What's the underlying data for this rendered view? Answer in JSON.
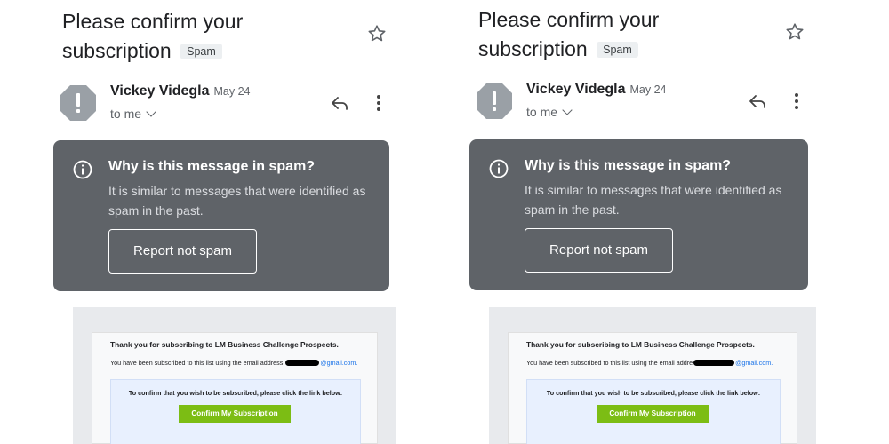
{
  "panels": [
    {
      "subject": "Please confirm your subscription",
      "spam_label": "Spam",
      "sender_name": "Vickey Videgla",
      "date": "May 24",
      "recipient": "to me",
      "warning": {
        "title": "Why is this message in spam?",
        "body": "It is similar to messages that were identified as spam in the past.",
        "button_label": "Report not spam"
      },
      "email_preview": {
        "thanks_line": "Thank you for subscribing to LM Business Challenge Prospects.",
        "subscribed_prefix": "You have been subscribed to this list using the email address",
        "email_suffix": "@gmail.com.",
        "confirm_instruction": "To confirm that you wish to be subscribed, please click the link below:",
        "confirm_button": "Confirm My Subscription"
      }
    },
    {
      "subject": "Please confirm your subscription",
      "spam_label": "Spam",
      "sender_name": "Vickey Videgla",
      "date": "May 24",
      "recipient": "to me",
      "warning": {
        "title": "Why is this message in spam?",
        "body": "It is similar to messages that were identified as spam in the past.",
        "button_label": "Report not spam"
      },
      "email_preview": {
        "thanks_line": "Thank you for subscribing to LM Business Challenge Prospects.",
        "subscribed_prefix": "You have been subscribed to this list using the email addre",
        "email_suffix": "@gmail.com.",
        "confirm_instruction": "To confirm that you wish to be subscribed, please click the link below:",
        "confirm_button": "Confirm My Subscription"
      }
    }
  ],
  "icons": {
    "star": "star-outline-icon",
    "avatar": "spam-warning-avatar-icon",
    "reply": "reply-icon",
    "more": "more-vert-icon",
    "info": "info-icon",
    "chevron": "chevron-down-icon"
  },
  "colors": {
    "warning_bg": "#5f6368",
    "avatar_bg": "#9aa0a6",
    "confirm_button_bg": "#7cbd14",
    "link": "#1a73e8"
  }
}
